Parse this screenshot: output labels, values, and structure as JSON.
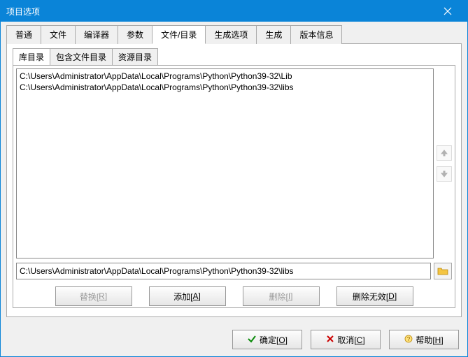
{
  "title": "项目选项",
  "mainTabs": [
    "普通",
    "文件",
    "编译器",
    "参数",
    "文件/目录",
    "生成选项",
    "生成",
    "版本信息"
  ],
  "activeMainTab": 4,
  "subTabs": [
    "库目录",
    "包含文件目录",
    "资源目录"
  ],
  "activeSubTab": 0,
  "listItems": [
    "C:\\Users\\Administrator\\AppData\\Local\\Programs\\Python\\Python39-32\\Lib",
    "C:\\Users\\Administrator\\AppData\\Local\\Programs\\Python\\Python39-32\\libs"
  ],
  "pathField": "C:\\Users\\Administrator\\AppData\\Local\\Programs\\Python\\Python39-32\\libs",
  "actions": {
    "replace": {
      "text": "替换[",
      "u": "R",
      "after": "]"
    },
    "add": {
      "text": "添加[",
      "u": "A",
      "after": "]"
    },
    "delete": {
      "text": "删除[",
      "u": "I",
      "after": "]"
    },
    "deleteInvalid": {
      "text": "删除无效[",
      "u": "D",
      "after": "]"
    }
  },
  "footer": {
    "ok": {
      "text": "确定[",
      "u": "O",
      "after": "]"
    },
    "cancel": {
      "text": "取消[",
      "u": "C",
      "after": "]"
    },
    "help": {
      "text": "帮助[",
      "u": "H",
      "after": "]"
    }
  }
}
